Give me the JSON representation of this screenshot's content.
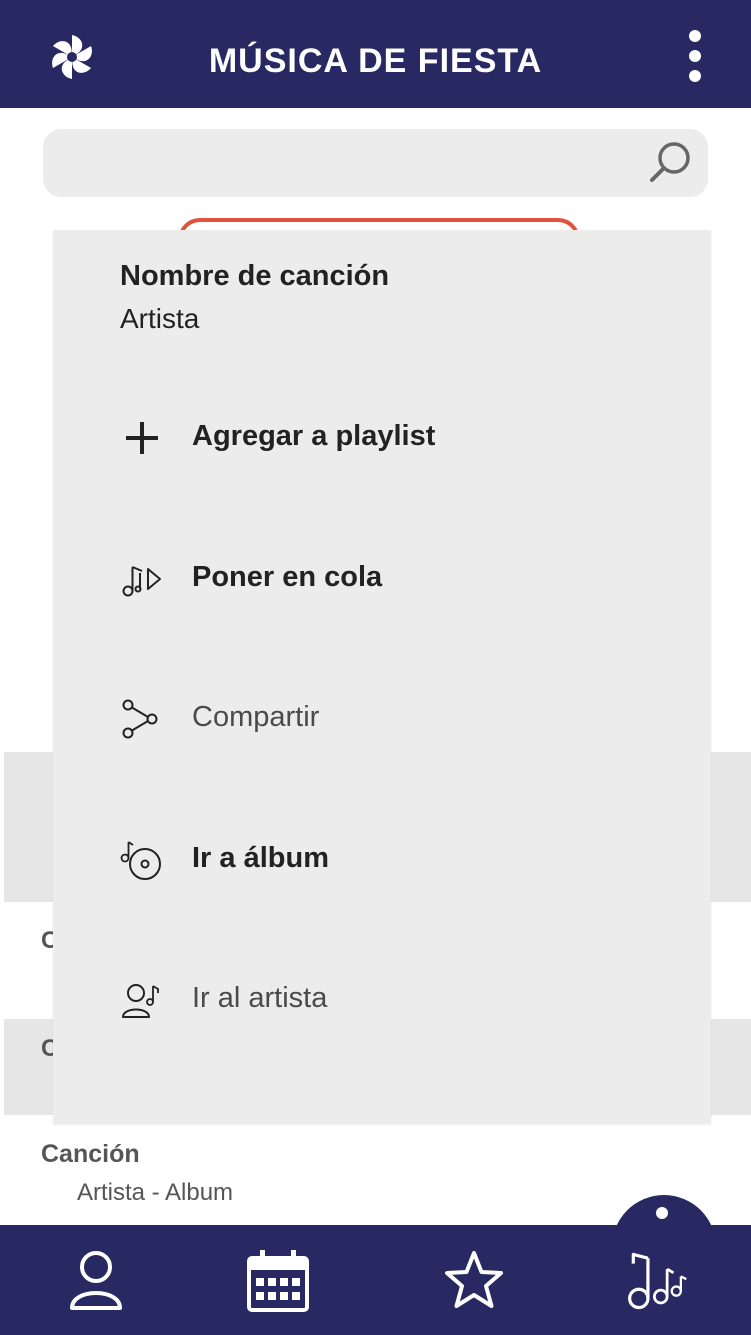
{
  "header": {
    "title": "MÚSICA DE FIESTA",
    "logo_icon": "pinwheel-logo",
    "menu_icon": "kebab-menu-icon"
  },
  "search": {
    "placeholder": "",
    "icon": "search-icon"
  },
  "song_menu": {
    "song_name": "Nombre de canción",
    "artist": "Artista",
    "items": [
      {
        "label": "Agregar a playlist",
        "icon": "plus-icon"
      },
      {
        "label": "Poner en cola",
        "icon": "queue-music-icon"
      },
      {
        "label": "Compartir",
        "icon": "share-icon"
      },
      {
        "label": "Ir a álbum",
        "icon": "album-icon"
      },
      {
        "label": "Ir al artista",
        "icon": "artist-icon"
      }
    ]
  },
  "background_list": {
    "rows": [
      {
        "title_peek": "C"
      },
      {
        "title_peek": "C"
      }
    ],
    "last_row": {
      "title": "Canción",
      "subtitle": "Artista - Album"
    }
  },
  "bottom_nav": {
    "items": [
      "profile-icon",
      "calendar-icon",
      "star-icon",
      "music-notes-icon"
    ]
  },
  "colors": {
    "primary": "#282962",
    "accent": "#e0523b",
    "menu_bg": "#ececec"
  }
}
